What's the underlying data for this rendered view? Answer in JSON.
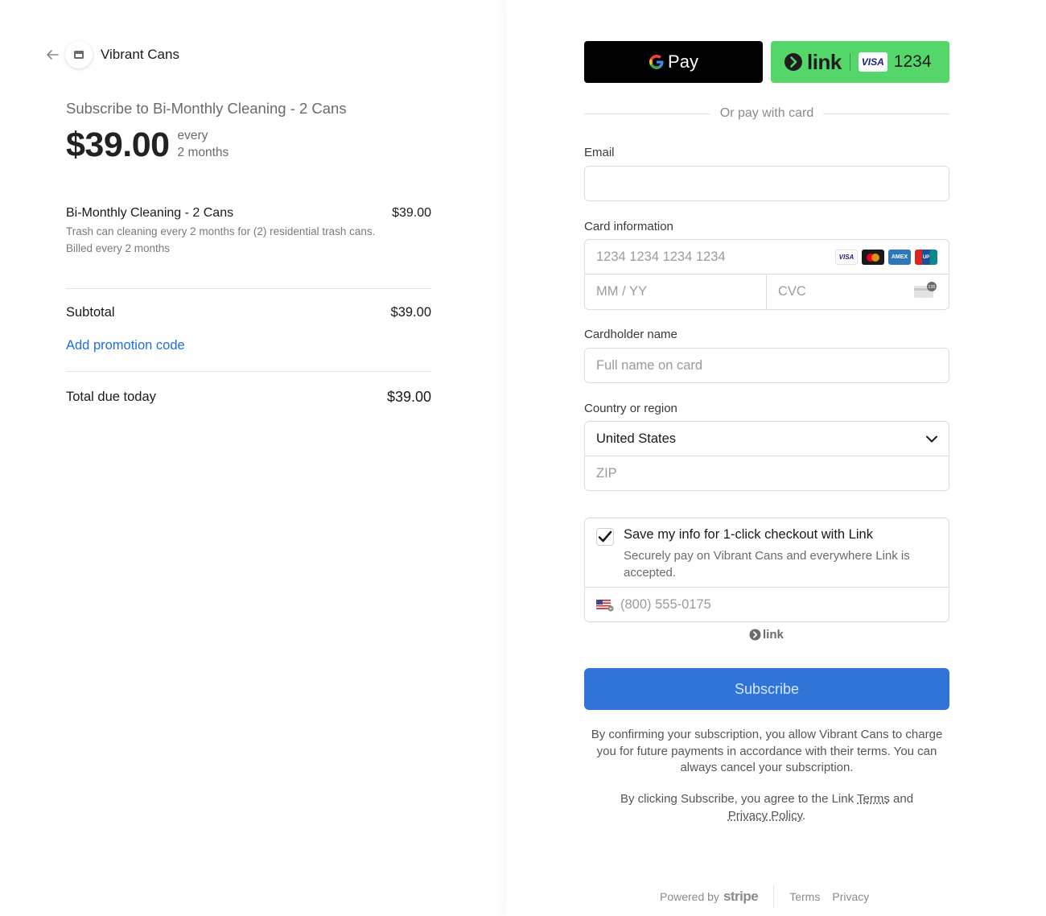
{
  "merchant": {
    "name": "Vibrant Cans"
  },
  "summary": {
    "title": "Subscribe to Bi-Monthly Cleaning - 2 Cans",
    "price": "$39.00",
    "interval_line1": "every",
    "interval_line2": "2 months"
  },
  "line_item": {
    "name": "Bi-Monthly Cleaning - 2 Cans",
    "price": "$39.00",
    "description": "Trash can cleaning every 2 months for (2) residential trash cans.",
    "billing": "Billed every 2 months"
  },
  "totals": {
    "subtotal_label": "Subtotal",
    "subtotal_value": "$39.00",
    "promo_label": "Add promotion code",
    "total_label": "Total due today",
    "total_value": "$39.00"
  },
  "express": {
    "gpay_label": "Pay",
    "link_label": "link",
    "link_card_brand": "VISA",
    "link_card_last4": "1234"
  },
  "divider_text": "Or pay with card",
  "form": {
    "email_label": "Email",
    "email_value": "",
    "card_label": "Card information",
    "card_number_placeholder": "1234 1234 1234 1234",
    "expiry_placeholder": "MM / YY",
    "cvc_placeholder": "CVC",
    "cvc_badge": "135",
    "brands": [
      "VISA",
      "MC",
      "AMEX",
      "UnionPay"
    ],
    "cardholder_label": "Cardholder name",
    "cardholder_placeholder": "Full name on card",
    "country_label": "Country or region",
    "country_value": "United States",
    "zip_placeholder": "ZIP"
  },
  "link_save": {
    "checked": true,
    "title": "Save my info for 1-click checkout with Link",
    "description": "Securely pay on Vibrant Cans and everywhere Link is accepted.",
    "phone_placeholder": "(800) 555-0175",
    "brand": "link"
  },
  "subscribe_button": "Subscribe",
  "legal": {
    "confirm_text": "By confirming your subscription, you allow Vibrant Cans to charge you for future payments in accordance with their terms. You can always cancel your subscription.",
    "agree_prefix": "By clicking Subscribe, you agree to the Link ",
    "terms": "Terms",
    "and": " and",
    "privacy": "Privacy Policy",
    "period": "."
  },
  "footer": {
    "powered_by": "Powered by",
    "stripe": "stripe",
    "terms": "Terms",
    "privacy": "Privacy"
  },
  "colors": {
    "accent": "#2f74d6",
    "link_green": "#55d66b",
    "promo_blue": "#1f6fd1"
  }
}
